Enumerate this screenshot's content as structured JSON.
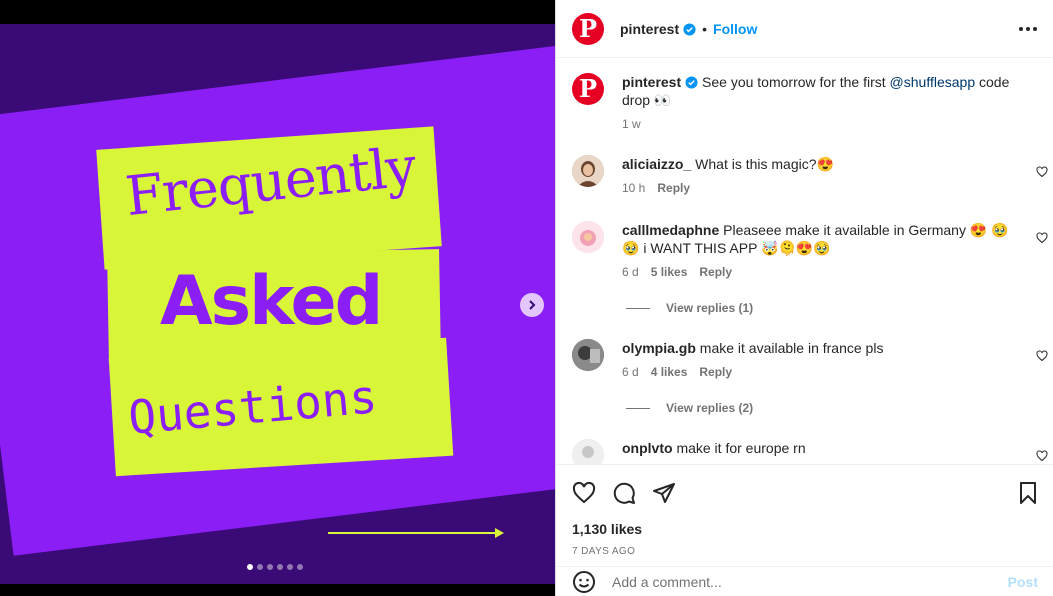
{
  "media": {
    "line1": "Frequently",
    "line2": "Asked",
    "line3": "Questions",
    "dots_count": 6,
    "active_dot": 0,
    "colors": {
      "purple": "#8a1ef5",
      "dark_purple": "#3a0a76",
      "lime": "#d8f538"
    }
  },
  "header": {
    "username": "pinterest",
    "follow_label": "Follow",
    "separator": "•"
  },
  "caption": {
    "username": "pinterest",
    "text_before": "See you tomorrow for the first ",
    "mention": "@shufflesapp",
    "text_after": " code drop 👀",
    "time": "1 w"
  },
  "comments": [
    {
      "username": "aliciaizzo_",
      "text": "What is this magic?😍",
      "time": "10 h",
      "likes": "",
      "reply": "Reply",
      "view_replies": ""
    },
    {
      "username": "calllmedaphne",
      "text": "Pleaseee make it available in Germany 😍 🥹🥹 i WANT THIS APP 🤯🫠😍🥹",
      "time": "6 d",
      "likes": "5 likes",
      "reply": "Reply",
      "view_replies": "View replies (1)"
    },
    {
      "username": "olympia.gb",
      "text": "make it available in france pls",
      "time": "6 d",
      "likes": "4 likes",
      "reply": "Reply",
      "view_replies": "View replies (2)"
    },
    {
      "username": "onplvto",
      "text": "make it for europe rn",
      "time": "",
      "likes": "",
      "reply": "",
      "view_replies": ""
    }
  ],
  "actions": {
    "likes": "1,130 likes",
    "date": "7 DAYS AGO"
  },
  "add_comment": {
    "placeholder": "Add a comment...",
    "post_label": "Post"
  }
}
